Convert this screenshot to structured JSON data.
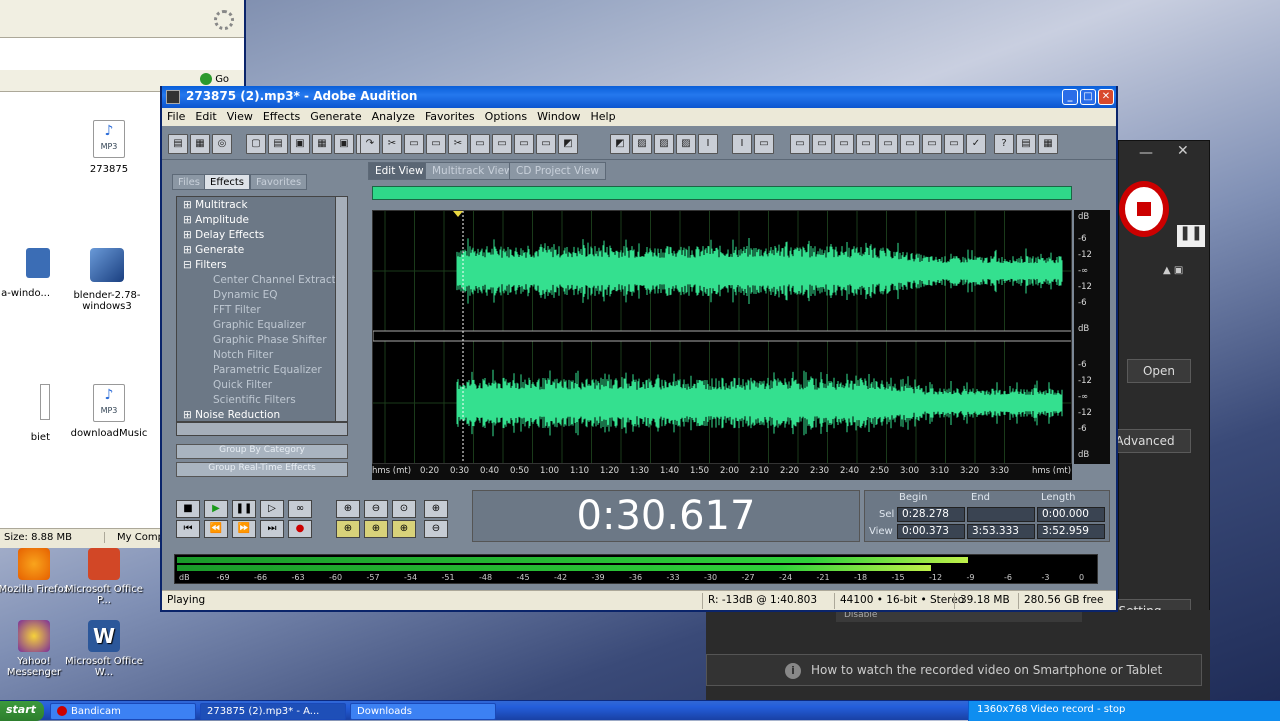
{
  "explorer": {
    "items": [
      {
        "name": "273875",
        "type": "mp3"
      },
      {
        "name": "a-windo...",
        "type": "installer"
      },
      {
        "name": "blender-2.78-windows3",
        "type": "installer"
      },
      {
        "name": "biet",
        "type": "mp3"
      },
      {
        "name": "downloadMusic",
        "type": "mp3"
      }
    ],
    "go_label": "Go",
    "status_size": "Size: 8.88 MB",
    "status_location": "My Comp"
  },
  "desktop": {
    "icons": [
      {
        "label": "Mozilla Firefox",
        "color": "#e66000"
      },
      {
        "label": "Microsoft Office P...",
        "color": "#d24726"
      },
      {
        "label": "Yahoo! Messenger",
        "color": "#7b2d9a"
      },
      {
        "label": "Microsoft Office W...",
        "color": "#2b579a"
      }
    ]
  },
  "bandicam": {
    "open": "Open",
    "advanced": "Advanced",
    "setting": "Setting",
    "disable": "Disable",
    "tip": "How to watch the recorded video on Smartphone or Tablet"
  },
  "taskbar": {
    "start": "start",
    "buttons": [
      "Bandicam",
      "273875 (2).mp3* - A...",
      "Downloads"
    ],
    "tray": "1360x768   Video record - stop"
  },
  "audition": {
    "title": "273875 (2).mp3* - Adobe Audition",
    "menu": [
      "File",
      "Edit",
      "View",
      "Effects",
      "Generate",
      "Analyze",
      "Favorites",
      "Options",
      "Window",
      "Help"
    ],
    "left_tabs": [
      "Files",
      "Effects",
      "Favorites"
    ],
    "active_left_tab": "Effects",
    "tree": [
      {
        "label": "Multitrack",
        "level": 0,
        "expanded": false
      },
      {
        "label": "Amplitude",
        "level": 0,
        "expanded": false
      },
      {
        "label": "Delay Effects",
        "level": 0,
        "expanded": false
      },
      {
        "label": "Generate",
        "level": 0,
        "expanded": false
      },
      {
        "label": "Filters",
        "level": 0,
        "expanded": true
      },
      {
        "label": "Center Channel Extractor",
        "level": 1
      },
      {
        "label": "Dynamic EQ",
        "level": 1
      },
      {
        "label": "FFT Filter",
        "level": 1
      },
      {
        "label": "Graphic Equalizer",
        "level": 1
      },
      {
        "label": "Graphic Phase Shifter",
        "level": 1
      },
      {
        "label": "Notch Filter",
        "level": 1
      },
      {
        "label": "Parametric Equalizer",
        "level": 1
      },
      {
        "label": "Quick Filter",
        "level": 1
      },
      {
        "label": "Scientific Filters",
        "level": 1
      },
      {
        "label": "Noise Reduction",
        "level": 0,
        "expanded": false
      }
    ],
    "group_by_category": "Group By Category",
    "group_realtime": "Group Real-Time Effects",
    "view_tabs": [
      "Edit View",
      "Multitrack View",
      "CD Project View"
    ],
    "active_view_tab": "Edit View",
    "db_labels": [
      "dB",
      "-6",
      "-12",
      "-∞",
      "-12",
      "-6",
      "dB",
      "-6",
      "-12",
      "-∞",
      "-12",
      "-6",
      "dB"
    ],
    "ruler": [
      "hms (mt)",
      "0:20",
      "0:30",
      "0:40",
      "0:50",
      "1:00",
      "1:10",
      "1:20",
      "1:30",
      "1:40",
      "1:50",
      "2:00",
      "2:10",
      "2:20",
      "2:30",
      "2:40",
      "2:50",
      "3:00",
      "3:10",
      "3:20",
      "3:30",
      "hms (mt)"
    ],
    "time_display": "0:30.617",
    "selection": {
      "begin_label": "Begin",
      "end_label": "End",
      "length_label": "Length",
      "sel_label": "Sel",
      "view_label": "View",
      "sel_begin": "0:28.278",
      "sel_end": "",
      "sel_length": "0:00.000",
      "view_begin": "0:00.373",
      "view_end": "3:53.333",
      "view_length": "3:52.959"
    },
    "meter_labels": [
      "dB",
      "-69",
      "-66",
      "-63",
      "-60",
      "-57",
      "-54",
      "-51",
      "-48",
      "-45",
      "-42",
      "-39",
      "-36",
      "-33",
      "-30",
      "-27",
      "-24",
      "-21",
      "-18",
      "-15",
      "-12",
      "-9",
      "-6",
      "-3",
      "0"
    ],
    "meter_levels": [
      0.86,
      0.82
    ],
    "status": {
      "state": "Playing",
      "readout": "R: -13dB @  1:40.803",
      "format": "44100 • 16-bit • Stereo",
      "file_size": "39.18 MB",
      "free": "280.56 GB free"
    },
    "colors": {
      "waveform": "#34e08f",
      "meter": "#2fd03a"
    }
  }
}
